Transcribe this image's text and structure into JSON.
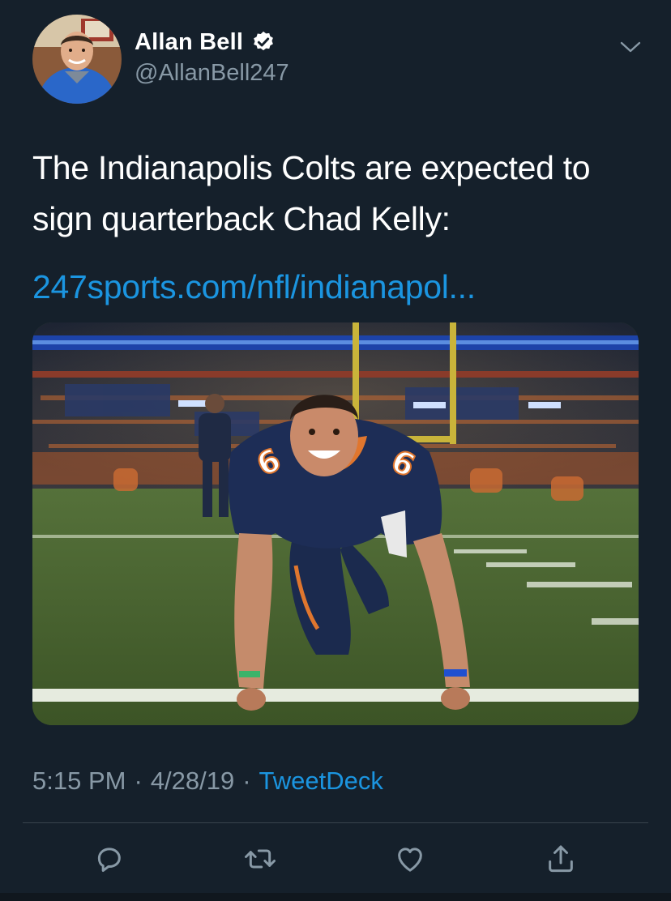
{
  "author": {
    "display_name": "Allan Bell",
    "handle": "@AllanBell247",
    "verified": true
  },
  "tweet": {
    "text": "The Indianapolis Colts are expected to sign quarterback Chad Kelly:",
    "link": "247sports.com/nfl/indianapol..."
  },
  "media": {
    "jersey_number": "6"
  },
  "meta": {
    "time": "5:15 PM",
    "separator": "·",
    "date": "4/28/19",
    "source": "TweetDeck"
  },
  "actions": {
    "icons": [
      "reply-icon",
      "retweet-icon",
      "like-icon",
      "share-icon"
    ]
  },
  "colors": {
    "background": "#15202b",
    "link": "#1b95e0",
    "secondary_text": "#8899a6",
    "divider": "#38444d"
  }
}
